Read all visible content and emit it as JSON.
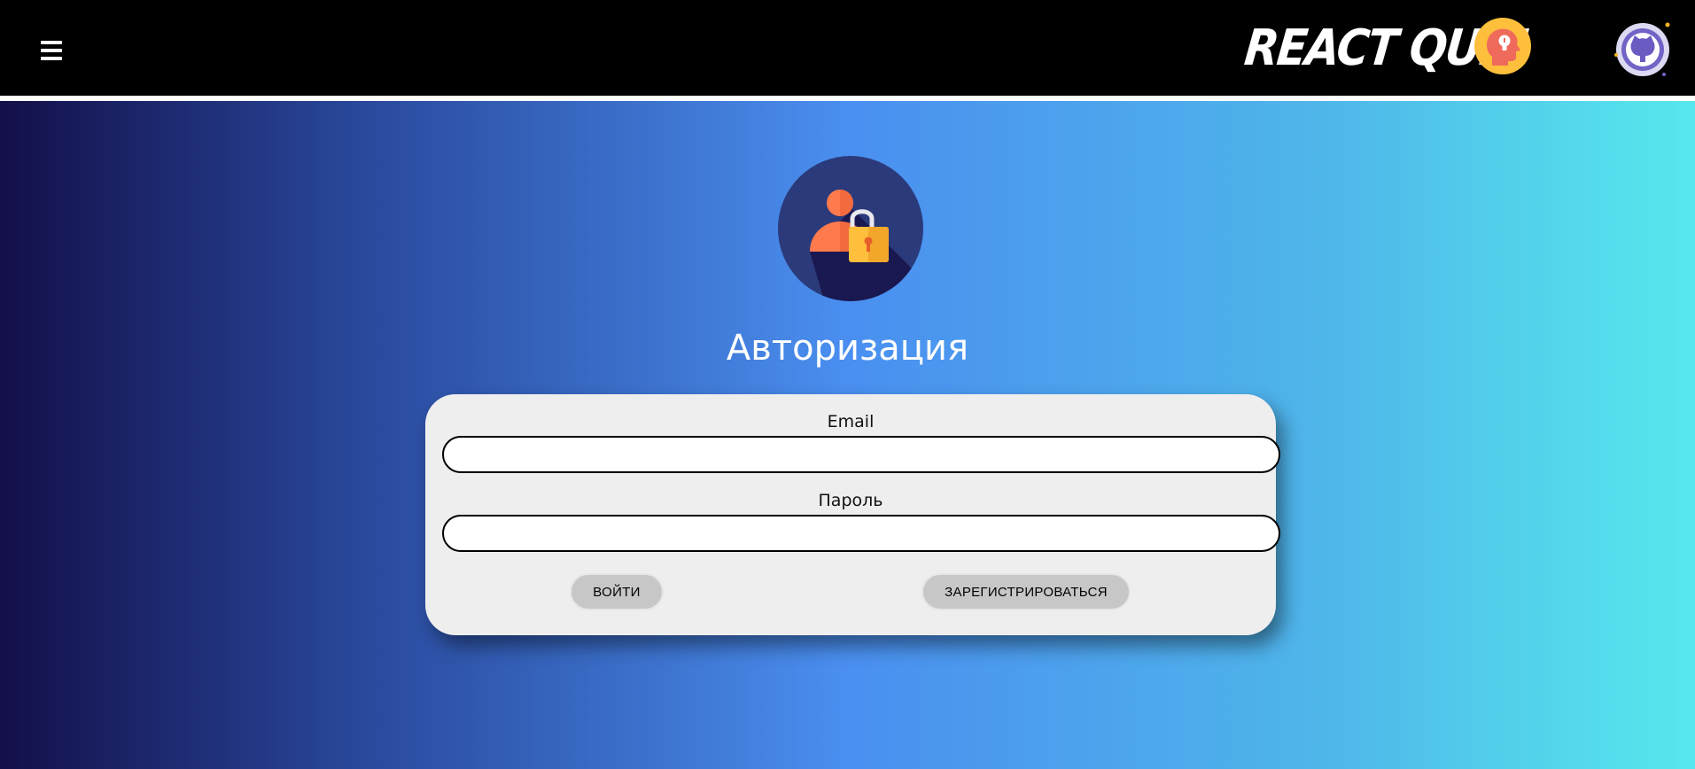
{
  "header": {
    "menu_icon": "hamburger-menu-icon",
    "brand_title": "REACT QUIZ",
    "brand_logo_icon": "head-lightbulb-icon",
    "github_icon": "github-octocat-icon"
  },
  "auth": {
    "icon": "user-lock-icon",
    "title": "Авторизация"
  },
  "form": {
    "email_label": "Email",
    "email_value": "",
    "password_label": "Пароль",
    "password_value": "",
    "login_button": "ВОЙТИ",
    "register_button": "ЗАРЕГИСТРИРОВАТЬСЯ"
  },
  "colors": {
    "header_bg": "#000000",
    "gradient_start": "#130f4a",
    "gradient_mid": "#4a8ff0",
    "gradient_end": "#56e8ec",
    "card_bg": "#eeeeee",
    "button_bg": "#c7c7c7"
  }
}
